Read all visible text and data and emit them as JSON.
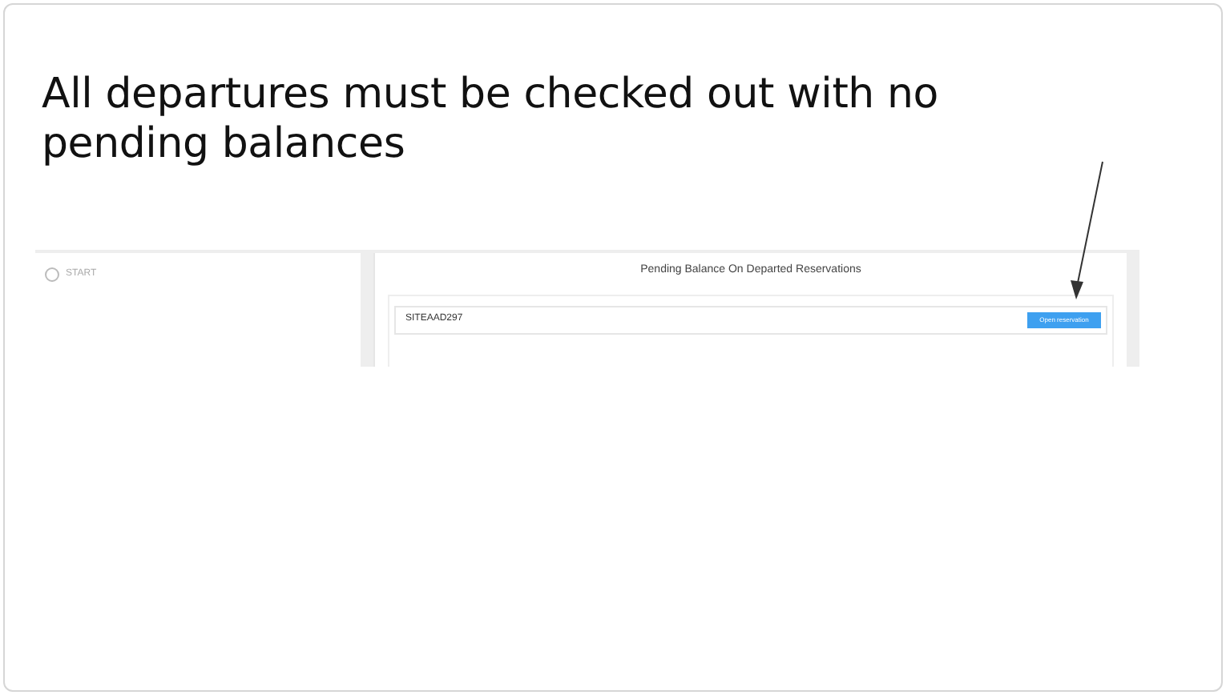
{
  "slide_title": "All departures must be checked out with no pending balances",
  "screenshot": {
    "steps": [
      {
        "label": "START"
      }
    ],
    "panel_title": "Pending Balance On Departed Reservations",
    "rows": [
      {
        "code": "SITEAAD297",
        "button": "Open reservation"
      }
    ]
  },
  "annotation": {
    "kind": "arrow"
  }
}
